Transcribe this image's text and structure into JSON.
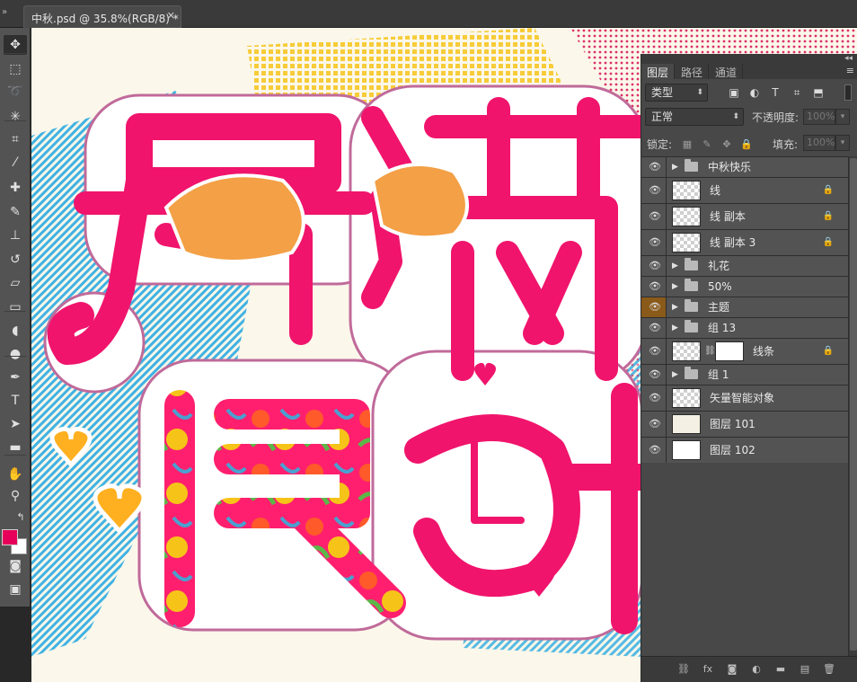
{
  "document": {
    "tab_title": "中秋.psd @ 35.8%(RGB/8) *",
    "close_glyph": "✕",
    "collapse_glyph": "»"
  },
  "colors": {
    "foreground": "#e6005a",
    "background": "#ffffff",
    "magenta": "#f0146c",
    "accent_orange": "#8a5a1a"
  },
  "toolbar": {
    "tools": [
      {
        "name": "move-tool",
        "glyph": "✥",
        "active": true
      },
      {
        "name": "marquee-tool",
        "glyph": "⬚"
      },
      {
        "name": "lasso-tool",
        "glyph": "➰"
      },
      {
        "name": "magic-wand-tool",
        "glyph": "✳"
      },
      {
        "name": "crop-tool",
        "glyph": "⌗"
      },
      {
        "name": "eyedropper-tool",
        "glyph": "⁄"
      },
      {
        "name": "healing-brush-tool",
        "glyph": "✚"
      },
      {
        "name": "brush-tool",
        "glyph": "✎"
      },
      {
        "name": "clone-stamp-tool",
        "glyph": "⊥"
      },
      {
        "name": "history-brush-tool",
        "glyph": "↺"
      },
      {
        "name": "eraser-tool",
        "glyph": "▱"
      },
      {
        "name": "gradient-tool",
        "glyph": "▭"
      },
      {
        "name": "blur-tool",
        "glyph": "◖"
      },
      {
        "name": "dodge-tool",
        "glyph": "●"
      },
      {
        "name": "pen-tool",
        "glyph": "✒"
      },
      {
        "name": "type-tool",
        "glyph": "T"
      },
      {
        "name": "path-selection-tool",
        "glyph": "➤"
      },
      {
        "name": "shape-tool",
        "glyph": "▬"
      },
      {
        "name": "hand-tool",
        "glyph": "✋"
      },
      {
        "name": "zoom-tool",
        "glyph": "⚲"
      }
    ],
    "swap_glyph": "↰",
    "quickmask_glyph": "◙",
    "screenmode_glyph": "▣"
  },
  "layers_panel": {
    "tabs": [
      "图层",
      "路径",
      "通道"
    ],
    "menu_glyph": "≡",
    "collapse_glyph": "◂◂",
    "filter_kind": "类型",
    "filter_icons": [
      "▣",
      "◐",
      "T",
      "⌗",
      "⬒"
    ],
    "blend_mode": "正常",
    "opacity_label": "不透明度:",
    "opacity_value": "100%",
    "lock_label": "锁定:",
    "lock_icons": [
      "▦",
      "✎",
      "✥",
      "🔒"
    ],
    "fill_label": "填充:",
    "fill_value": "100%",
    "eye_glyph": "👁",
    "arrow_glyph": "▶",
    "lock_glyph": "🔒",
    "link_glyph": "⛓",
    "layers": [
      {
        "name": "中秋快乐",
        "type": "group"
      },
      {
        "name": "线",
        "type": "layer",
        "locked": true
      },
      {
        "name": "线 副本",
        "type": "layer",
        "locked": true
      },
      {
        "name": "线 副本 3",
        "type": "layer",
        "locked": true
      },
      {
        "name": "礼花",
        "type": "group"
      },
      {
        "name": "50%",
        "type": "group"
      },
      {
        "name": "主题",
        "type": "group",
        "highlight_eye": true
      },
      {
        "name": "组 13",
        "type": "group"
      },
      {
        "name": "线条",
        "type": "masked",
        "locked": true
      },
      {
        "name": "组 1",
        "type": "group"
      },
      {
        "name": "矢量智能对象",
        "type": "smart"
      },
      {
        "name": "图层 101",
        "type": "fill-cream"
      },
      {
        "name": "图层 102",
        "type": "fill-white"
      }
    ],
    "footer_icons": [
      "⛓",
      "fx",
      "◙",
      "◐",
      "▬",
      "▤",
      "🗑"
    ]
  }
}
